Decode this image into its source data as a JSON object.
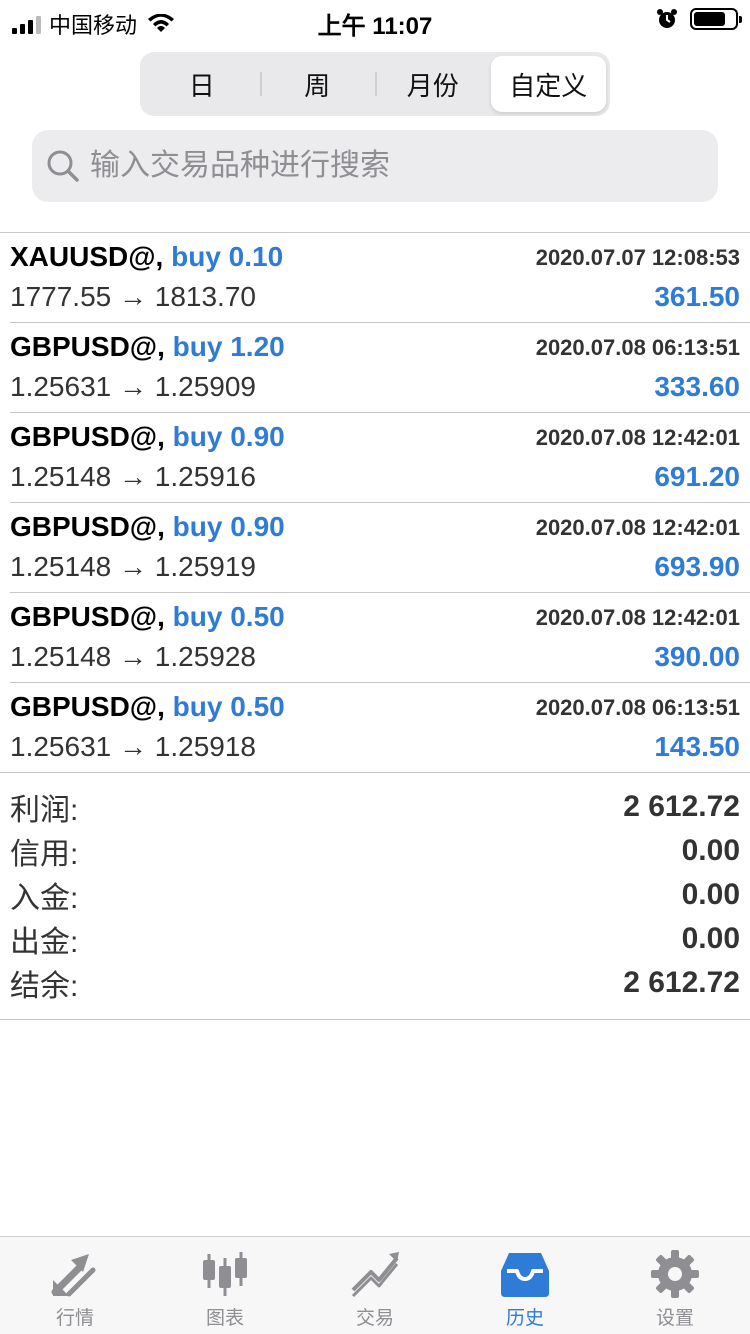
{
  "status_bar": {
    "carrier": "中国移动",
    "time": "上午 11:07"
  },
  "segments": [
    {
      "label": "日"
    },
    {
      "label": "周"
    },
    {
      "label": "月份"
    },
    {
      "label": "自定义",
      "active": true
    }
  ],
  "search": {
    "placeholder": "输入交易品种进行搜索"
  },
  "trades": [
    {
      "symbol": "XAUUSD@,",
      "side": "buy 0.10",
      "datetime": "2020.07.07 12:08:53",
      "prices": "1777.55 → 1813.70",
      "profit": "361.50"
    },
    {
      "symbol": "GBPUSD@,",
      "side": "buy 1.20",
      "datetime": "2020.07.08 06:13:51",
      "prices": "1.25631 → 1.25909",
      "profit": "333.60"
    },
    {
      "symbol": "GBPUSD@,",
      "side": "buy 0.90",
      "datetime": "2020.07.08 12:42:01",
      "prices": "1.25148 → 1.25916",
      "profit": "691.20"
    },
    {
      "symbol": "GBPUSD@,",
      "side": "buy 0.90",
      "datetime": "2020.07.08 12:42:01",
      "prices": "1.25148 → 1.25919",
      "profit": "693.90"
    },
    {
      "symbol": "GBPUSD@,",
      "side": "buy 0.50",
      "datetime": "2020.07.08 12:42:01",
      "prices": "1.25148 → 1.25928",
      "profit": "390.00"
    },
    {
      "symbol": "GBPUSD@,",
      "side": "buy 0.50",
      "datetime": "2020.07.08 06:13:51",
      "prices": "1.25631 → 1.25918",
      "profit": "143.50"
    }
  ],
  "summary": [
    {
      "label": "利润:",
      "value": "2 612.72"
    },
    {
      "label": "信用:",
      "value": "0.00"
    },
    {
      "label": "入金:",
      "value": "0.00"
    },
    {
      "label": "出金:",
      "value": "0.00"
    },
    {
      "label": "结余:",
      "value": "2 612.72"
    }
  ],
  "tabs": [
    {
      "label": "行情",
      "icon": "quotes-arrows-icon"
    },
    {
      "label": "图表",
      "icon": "candlestick-chart-icon"
    },
    {
      "label": "交易",
      "icon": "trade-trend-icon"
    },
    {
      "label": "历史",
      "icon": "history-inbox-icon",
      "active": true
    },
    {
      "label": "设置",
      "icon": "settings-gear-icon"
    }
  ],
  "colors": {
    "accent": "#2f7bd8",
    "inactive_tab": "#8e8e93"
  }
}
